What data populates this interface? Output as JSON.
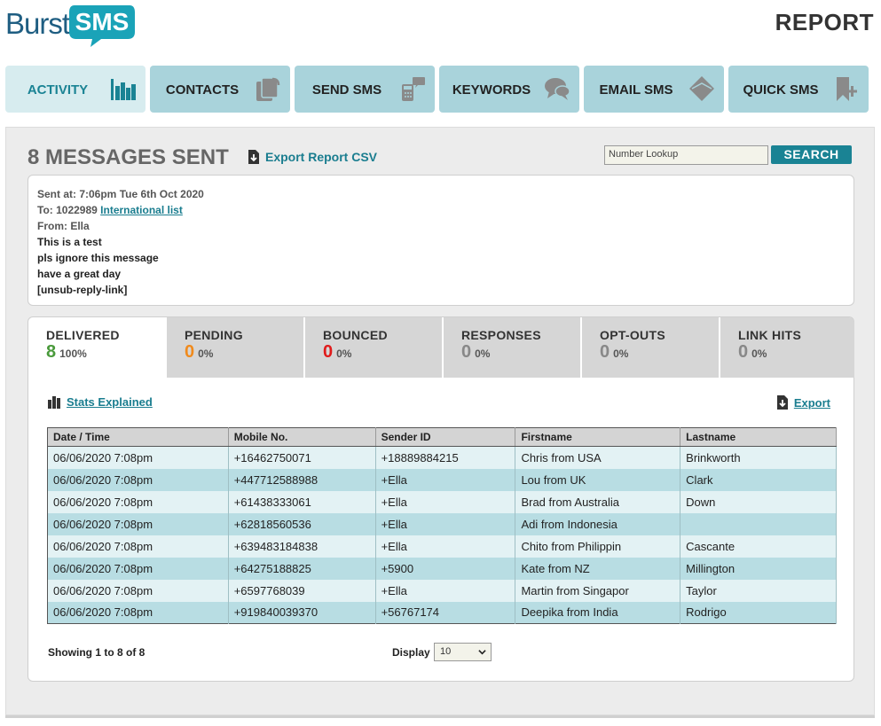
{
  "brand": {
    "logo_word": "Burst",
    "logo_bubble": "SMS"
  },
  "page_heading": "REPORT",
  "nav": [
    {
      "label": "ACTIVITY",
      "icon": "bar-chart-icon",
      "active": true
    },
    {
      "label": "CONTACTS",
      "icon": "contacts-icon",
      "active": false
    },
    {
      "label": "SEND SMS",
      "icon": "phone-send-icon",
      "active": false
    },
    {
      "label": "KEYWORDS",
      "icon": "chat-bubble-icon",
      "active": false
    },
    {
      "label": "EMAIL SMS",
      "icon": "envelope-icon",
      "active": false
    },
    {
      "label": "QUICK SMS",
      "icon": "bookmark-plus-icon",
      "active": false
    }
  ],
  "report": {
    "title": "8 MESSAGES SENT",
    "export_csv_label": "Export Report CSV",
    "lookup_placeholder": "Number Lookup",
    "search_label": "SEARCH"
  },
  "message": {
    "sent_at": "Sent at: 7:06pm Tue 6th Oct 2020",
    "to_prefix": "To: 1022989 ",
    "to_list": "International list",
    "from": "From: Ella",
    "lines": [
      "This is a test",
      "pls ignore this message",
      "have a great day",
      "[unsub-reply-link]"
    ]
  },
  "stat_tabs": [
    {
      "label": "DELIVERED",
      "value": "8",
      "pct": "100%",
      "color": "#4a9a3c"
    },
    {
      "label": "PENDING",
      "value": "0",
      "pct": "0%",
      "color": "#f08a1c"
    },
    {
      "label": "BOUNCED",
      "value": "0",
      "pct": "0%",
      "color": "#e01b1b"
    },
    {
      "label": "RESPONSES",
      "value": "0",
      "pct": "0%",
      "color": "#888888"
    },
    {
      "label": "OPT-OUTS",
      "value": "0",
      "pct": "0%",
      "color": "#888888"
    },
    {
      "label": "LINK HITS",
      "value": "0",
      "pct": "0%",
      "color": "#888888"
    }
  ],
  "stats_explained": "Stats Explained",
  "export_label": "Export",
  "table": {
    "columns": [
      "Date / Time",
      "Mobile No.",
      "Sender ID",
      "Firstname",
      "Lastname"
    ],
    "rows": [
      [
        "06/06/2020 7:08pm",
        "+16462750071",
        "+18889884215",
        "Chris from USA",
        "Brinkworth"
      ],
      [
        "06/06/2020 7:08pm",
        "+447712588988",
        "+Ella",
        "Lou from UK",
        "Clark"
      ],
      [
        "06/06/2020 7:08pm",
        "+61438333061",
        "+Ella",
        "Brad from Australia",
        "Down"
      ],
      [
        "06/06/2020 7:08pm",
        "+62818560536",
        "+Ella",
        "Adi from Indonesia",
        ""
      ],
      [
        "06/06/2020 7:08pm",
        "+639483184838",
        "+Ella",
        "Chito from Philippin",
        "Cascante"
      ],
      [
        "06/06/2020 7:08pm",
        "+64275188825",
        "+5900",
        "Kate from NZ",
        "Millington"
      ],
      [
        "06/06/2020 7:08pm",
        "+6597768039",
        "+Ella",
        "Martin from Singapor",
        "Taylor"
      ],
      [
        "06/06/2020 7:08pm",
        "+919840039370",
        "+56767174",
        "Deepika from India",
        "Rodrigo"
      ]
    ]
  },
  "pagination": {
    "showing": "Showing 1 to 8 of 8",
    "display_label": "Display",
    "display_value": "10"
  }
}
